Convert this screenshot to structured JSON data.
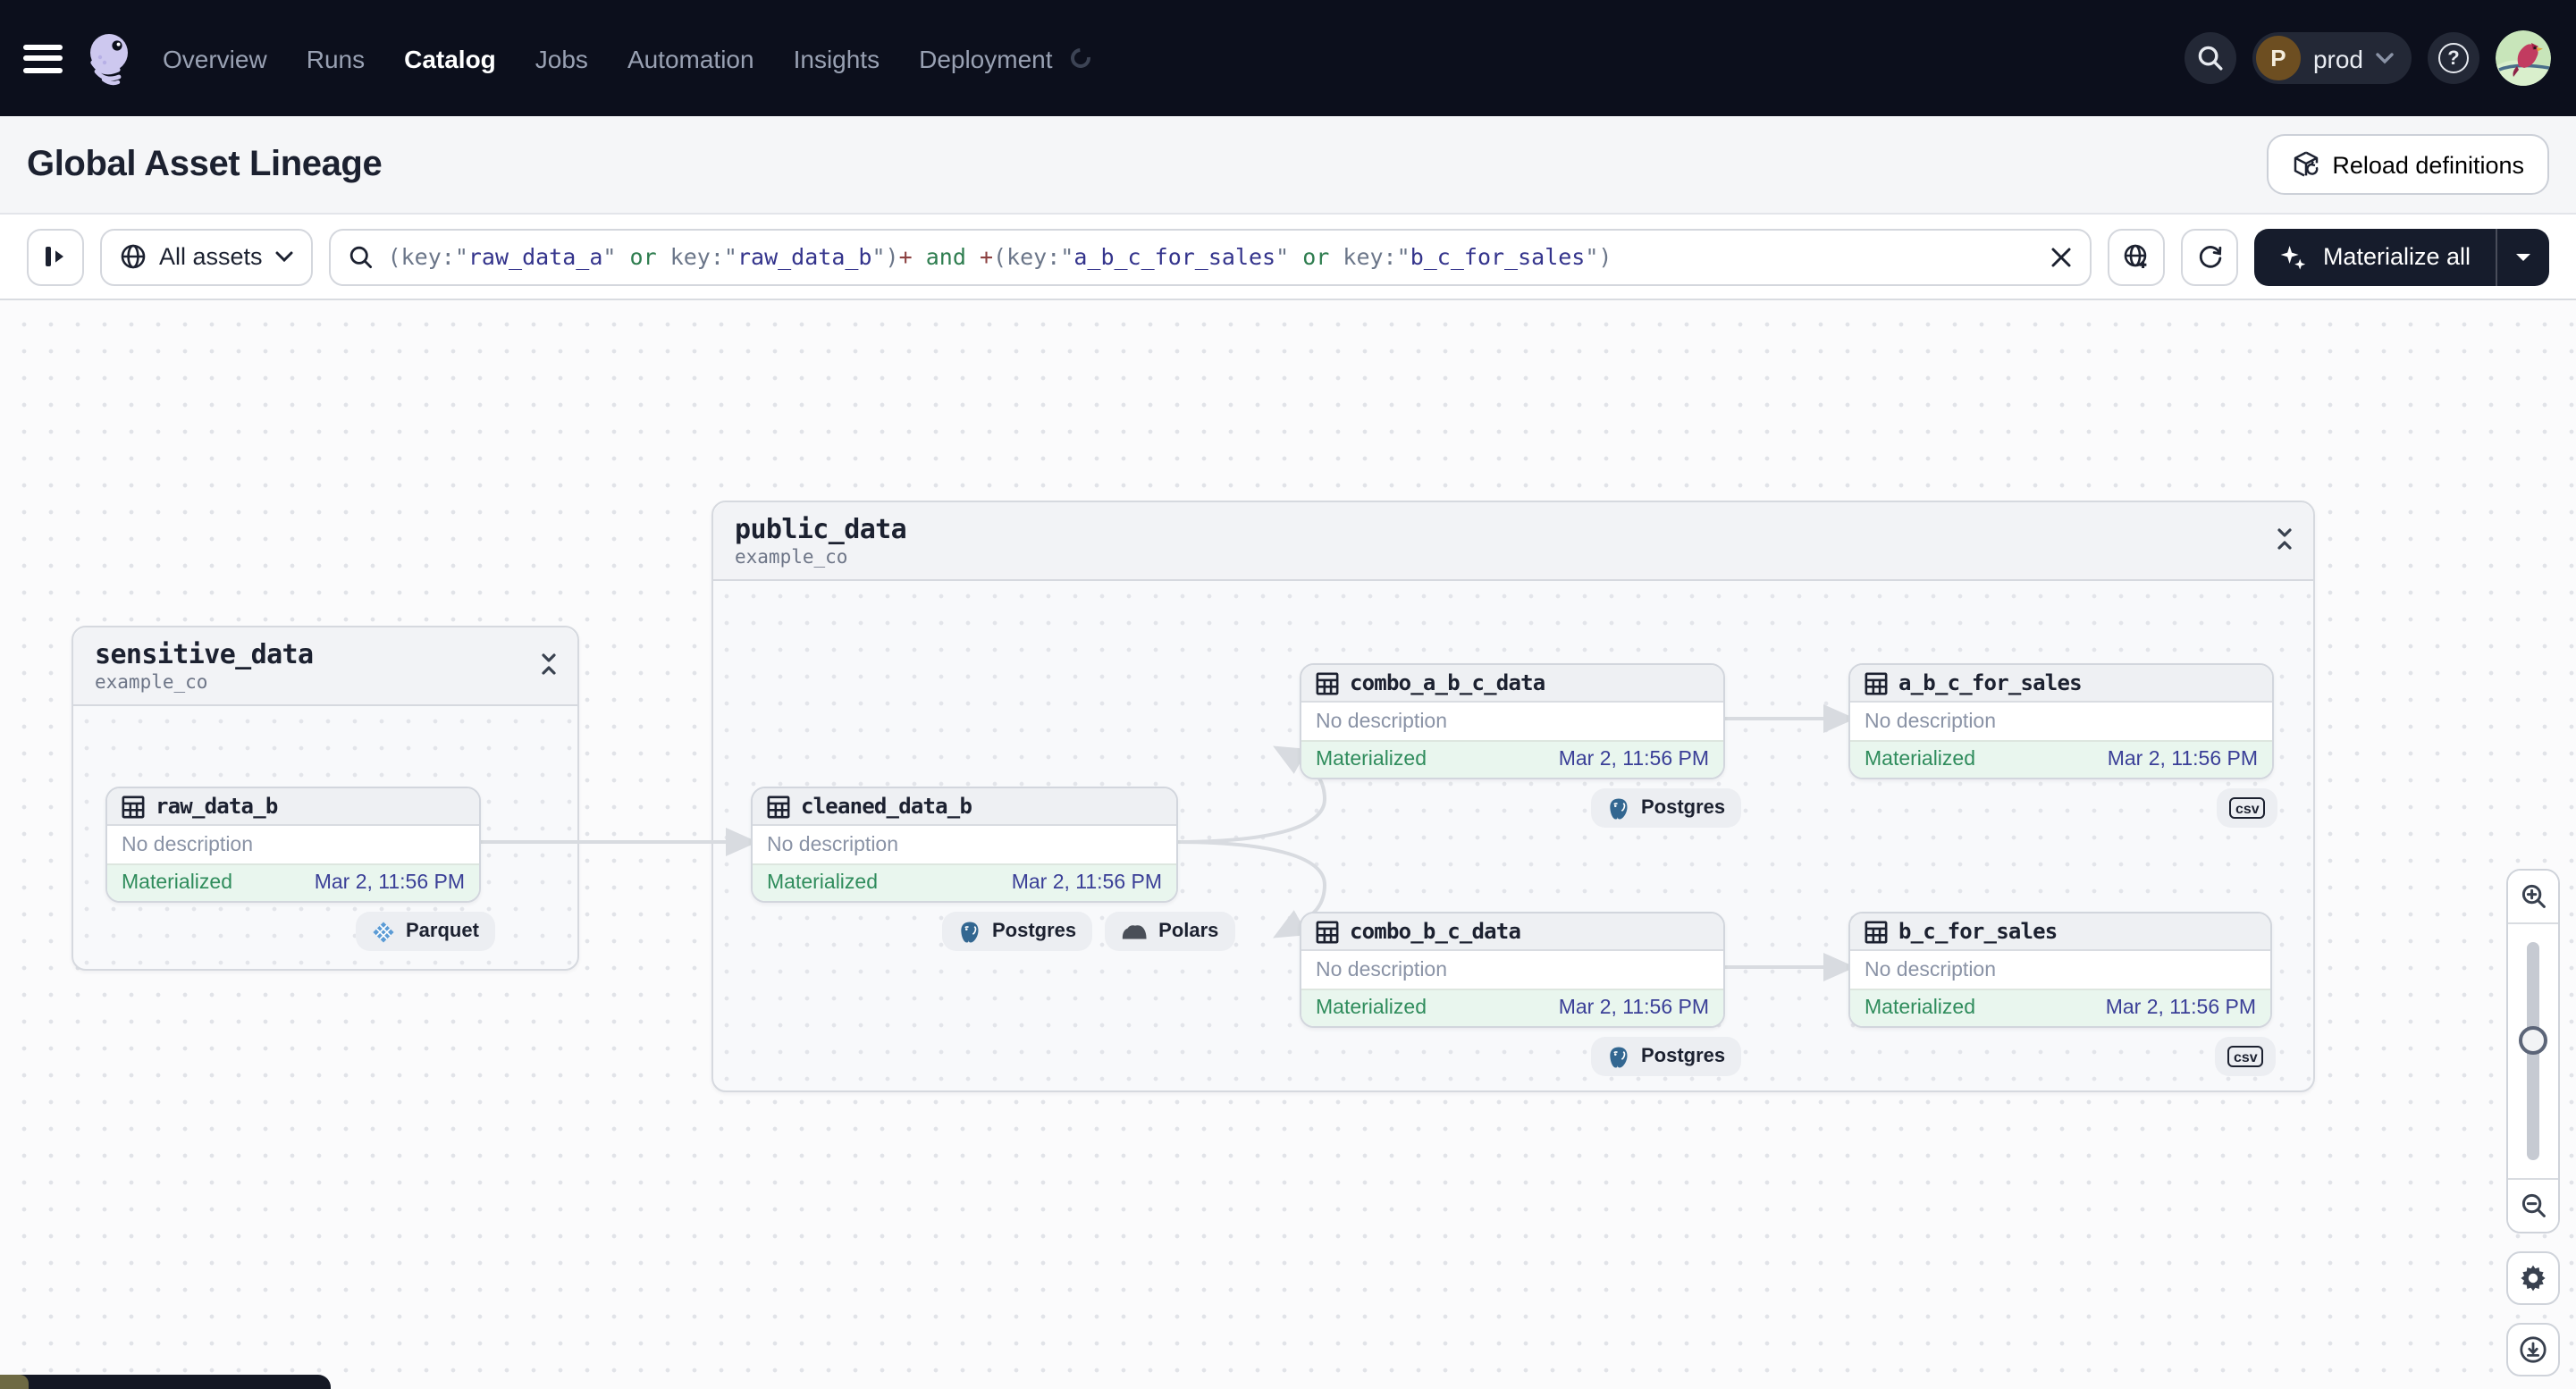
{
  "nav": {
    "items": [
      {
        "label": "Overview"
      },
      {
        "label": "Runs"
      },
      {
        "label": "Catalog"
      },
      {
        "label": "Jobs"
      },
      {
        "label": "Automation"
      },
      {
        "label": "Insights"
      },
      {
        "label": "Deployment"
      }
    ],
    "active_item": "Catalog",
    "workspace": {
      "initial": "P",
      "name": "prod"
    }
  },
  "header": {
    "title": "Global Asset Lineage",
    "reload_button_label": "Reload definitions"
  },
  "toolbar": {
    "asset_filter_label": "All assets",
    "materialize_button_label": "Materialize all",
    "query_segments": [
      {
        "text": "(key:\"",
        "type": "punct"
      },
      {
        "text": "raw_data_a",
        "type": "string"
      },
      {
        "text": "\"",
        "type": "punct"
      },
      {
        "text": " or ",
        "type": "keyword"
      },
      {
        "text": "key:\"",
        "type": "punct"
      },
      {
        "text": "raw_data_b",
        "type": "string"
      },
      {
        "text": "\")",
        "type": "punct"
      },
      {
        "text": "+",
        "type": "plus"
      },
      {
        "text": " and ",
        "type": "keyword"
      },
      {
        "text": "+",
        "type": "plus"
      },
      {
        "text": "(key:\"",
        "type": "punct"
      },
      {
        "text": "a_b_c_for_sales",
        "type": "string"
      },
      {
        "text": "\"",
        "type": "punct"
      },
      {
        "text": " or ",
        "type": "keyword"
      },
      {
        "text": "key:\"",
        "type": "punct"
      },
      {
        "text": "b_c_for_sales",
        "type": "string"
      },
      {
        "text": "\")",
        "type": "punct"
      }
    ]
  },
  "graph": {
    "groups": [
      {
        "name": "sensitive_data",
        "location": "example_co"
      },
      {
        "name": "public_data",
        "location": "example_co"
      }
    ],
    "nodes": [
      {
        "name": "raw_data_b",
        "description": "No description",
        "status": "Materialized",
        "timestamp": "Mar 2, 11:56 PM",
        "badges": [
          {
            "label": "Parquet"
          }
        ]
      },
      {
        "name": "cleaned_data_b",
        "description": "No description",
        "status": "Materialized",
        "timestamp": "Mar 2, 11:56 PM",
        "badges": [
          {
            "label": "Postgres"
          },
          {
            "label": "Polars"
          }
        ]
      },
      {
        "name": "combo_a_b_c_data",
        "description": "No description",
        "status": "Materialized",
        "timestamp": "Mar 2, 11:56 PM",
        "badges": [
          {
            "label": "Postgres"
          }
        ]
      },
      {
        "name": "a_b_c_for_sales",
        "description": "No description",
        "status": "Materialized",
        "timestamp": "Mar 2, 11:56 PM",
        "badges": [
          {
            "label": "csv"
          }
        ]
      },
      {
        "name": "combo_b_c_data",
        "description": "No description",
        "status": "Materialized",
        "timestamp": "Mar 2, 11:56 PM",
        "badges": [
          {
            "label": "Postgres"
          }
        ]
      },
      {
        "name": "b_c_for_sales",
        "description": "No description",
        "status": "Materialized",
        "timestamp": "Mar 2, 11:56 PM",
        "badges": [
          {
            "label": "csv"
          }
        ]
      }
    ]
  },
  "colors": {
    "nav_bg": "#0c0f1c",
    "button_dark": "#161c2c",
    "status_green": "#2f8c5c",
    "timestamp_indigo": "#3a3f97",
    "materialized_row_bg": "#e9f6ee",
    "edge_gray": "#d8dbe0",
    "logo_lavender": "#cdc8ef"
  }
}
